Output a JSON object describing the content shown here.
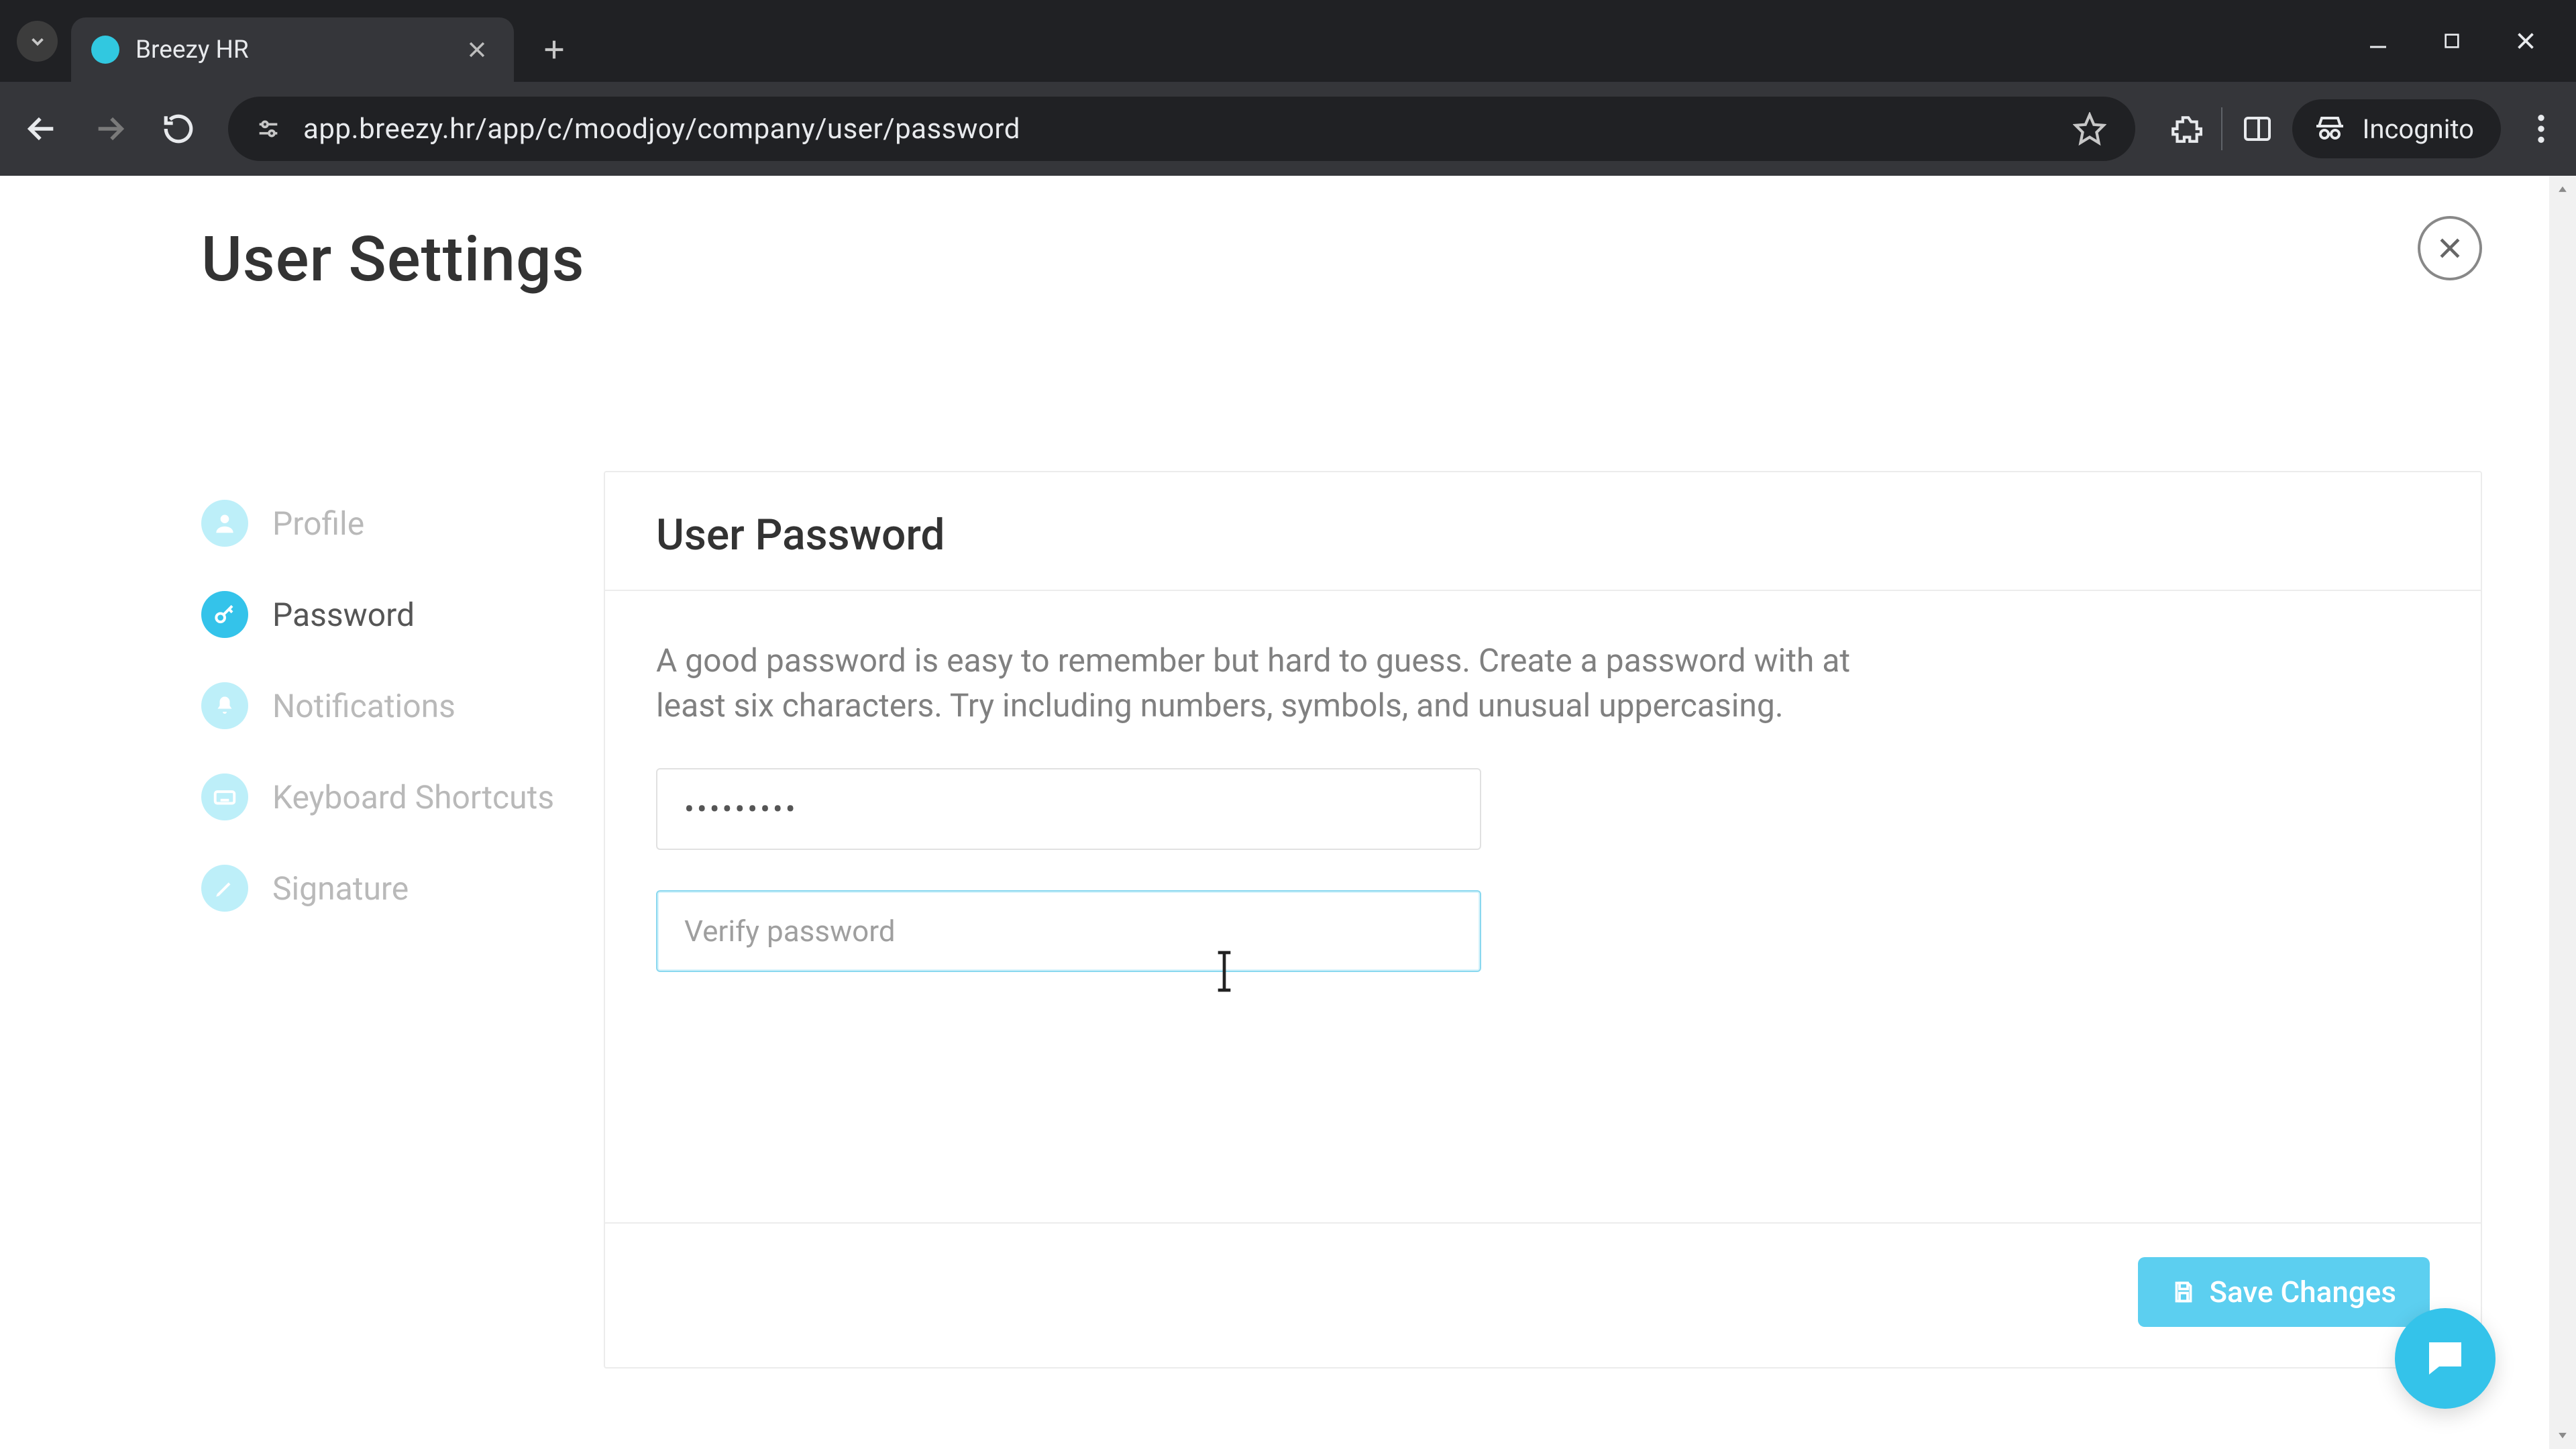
{
  "browser": {
    "tab_title": "Breezy HR",
    "url": "app.breezy.hr/app/c/moodjoy/company/user/password",
    "incognito_label": "Incognito"
  },
  "page": {
    "title": "User Settings"
  },
  "sidenav": {
    "items": [
      {
        "label": "Profile"
      },
      {
        "label": "Password"
      },
      {
        "label": "Notifications"
      },
      {
        "label": "Keyboard Shortcuts"
      },
      {
        "label": "Signature"
      }
    ],
    "active_index": 1
  },
  "panel": {
    "heading": "User Password",
    "description": "A good password is easy to remember but hard to guess. Create a password with at least six characters. Try including numbers, symbols, and unusual uppercasing.",
    "password_value": "•••••••••",
    "verify_placeholder": "Verify password",
    "save_label": "Save Changes"
  },
  "colors": {
    "accent": "#34c3ea",
    "accent_light": "#5ccff0"
  }
}
